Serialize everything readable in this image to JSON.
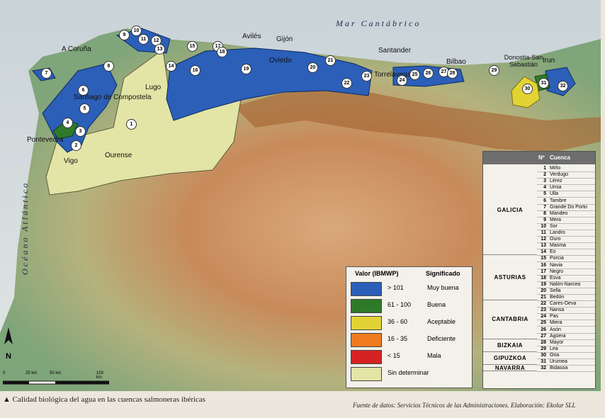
{
  "map": {
    "sea_label": "Mar Cantábrico",
    "ocean_label": "Océano Atlántico",
    "cities": [
      {
        "name": "A Coruña"
      },
      {
        "name": "Avilés"
      },
      {
        "name": "Gijón"
      },
      {
        "name": "Oviedo"
      },
      {
        "name": "Lugo"
      },
      {
        "name": "Santiago de Compostela"
      },
      {
        "name": "Pontevedra"
      },
      {
        "name": "Vigo"
      },
      {
        "name": "Ourense"
      },
      {
        "name": "Santander"
      },
      {
        "name": "Torrelavega"
      },
      {
        "name": "Bilbao"
      },
      {
        "name": "Donostia-San Sebastián"
      },
      {
        "name": "Irun"
      }
    ],
    "basin_markers": [
      "1",
      "2",
      "3",
      "4",
      "5",
      "6",
      "7",
      "8",
      "9",
      "10",
      "11",
      "12",
      "13",
      "14",
      "15",
      "16",
      "17",
      "18",
      "19",
      "20",
      "21",
      "22",
      "23",
      "24",
      "25",
      "26",
      "27",
      "28",
      "29",
      "30",
      "31",
      "32"
    ],
    "north_label": "N",
    "scale_labels": [
      "0",
      "25 km",
      "50 km",
      "100 km"
    ]
  },
  "legend": {
    "header_value": "Valor (IBMWP)",
    "header_meaning": "Significado",
    "rows": [
      {
        "value": "> 101",
        "meaning": "Muy buena",
        "color": "#2b5fb8"
      },
      {
        "value": "61 - 100",
        "meaning": "Buena",
        "color": "#2f7a2a"
      },
      {
        "value": "36 - 60",
        "meaning": "Aceptable",
        "color": "#e2d335"
      },
      {
        "value": "16 - 35",
        "meaning": "Deficiente",
        "color": "#ef7b1f"
      },
      {
        "value": "< 15",
        "meaning": "Mala",
        "color": "#d62222"
      },
      {
        "value": "",
        "meaning": "Sin determinar",
        "color": "#e2e5a6"
      }
    ]
  },
  "table": {
    "header_no": "Nº",
    "header_basin": "Cuenca",
    "regions": [
      {
        "name": "GALICIA",
        "basins": [
          {
            "n": "1",
            "name": "Miño"
          },
          {
            "n": "2",
            "name": "Verdugo"
          },
          {
            "n": "3",
            "name": "Lérez"
          },
          {
            "n": "4",
            "name": "Umia"
          },
          {
            "n": "5",
            "name": "Ulla"
          },
          {
            "n": "6",
            "name": "Tambre"
          },
          {
            "n": "7",
            "name": "Grande Do Porto"
          },
          {
            "n": "8",
            "name": "Mandeo"
          },
          {
            "n": "9",
            "name": "Mera"
          },
          {
            "n": "10",
            "name": "Sor"
          },
          {
            "n": "11",
            "name": "Landro"
          },
          {
            "n": "12",
            "name": "Ouro"
          },
          {
            "n": "13",
            "name": "Masma"
          },
          {
            "n": "14",
            "name": "Eo"
          }
        ]
      },
      {
        "name": "ASTURIAS",
        "basins": [
          {
            "n": "15",
            "name": "Porcia"
          },
          {
            "n": "16",
            "name": "Navia"
          },
          {
            "n": "17",
            "name": "Negro"
          },
          {
            "n": "18",
            "name": "Esva"
          },
          {
            "n": "19",
            "name": "Nalón-Narcea"
          },
          {
            "n": "20",
            "name": "Sella"
          },
          {
            "n": "21",
            "name": "Bedón"
          }
        ]
      },
      {
        "name": "CANTABRIA",
        "basins": [
          {
            "n": "22",
            "name": "Cares-Deva"
          },
          {
            "n": "23",
            "name": "Nansa"
          },
          {
            "n": "24",
            "name": "Pas"
          },
          {
            "n": "25",
            "name": "Miera"
          },
          {
            "n": "26",
            "name": "Asón"
          },
          {
            "n": "27",
            "name": "Agüera"
          }
        ]
      },
      {
        "name": "BIZKAIA",
        "basins": [
          {
            "n": "28",
            "name": "Mayor"
          },
          {
            "n": "29",
            "name": "Lea"
          }
        ]
      },
      {
        "name": "GIPUZKOA",
        "basins": [
          {
            "n": "30",
            "name": "Oria"
          },
          {
            "n": "31",
            "name": "Urumea"
          }
        ]
      },
      {
        "name": "NAVARRA",
        "basins": [
          {
            "n": "32",
            "name": "Bidasoa"
          }
        ]
      }
    ]
  },
  "caption": "▲ Calidad biológica del agua en las cuencas salmoneras ibéricas",
  "source": "Fuente de datos: Servicios Técnicos de las Administraciones. Elaboración: Ekolur SLL"
}
